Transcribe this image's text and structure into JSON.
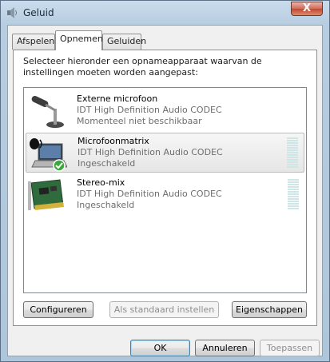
{
  "window": {
    "title": "Geluid",
    "close_glyph": "X"
  },
  "tabs": [
    {
      "label": "Afspelen",
      "active": false
    },
    {
      "label": "Opnemen",
      "active": true
    },
    {
      "label": "Geluiden",
      "active": false
    }
  ],
  "instruction": "Selecteer hieronder een opnameapparaat waarvan de instellingen moeten worden aangepast:",
  "devices": [
    {
      "name": "Externe microfoon",
      "driver": "IDT High Definition Audio CODEC",
      "status": "Momenteel niet beschikbaar",
      "icon": "desk-microphone-icon",
      "selected": false
    },
    {
      "name": "Microfoonmatrix",
      "driver": "IDT High Definition Audio CODEC",
      "status": "Ingeschakeld",
      "icon": "laptop-microphone-icon",
      "selected": true,
      "default_device": true
    },
    {
      "name": "Stereo-mix",
      "driver": "IDT High Definition Audio CODEC",
      "status": "Ingeschakeld",
      "icon": "sound-card-icon",
      "selected": false
    }
  ],
  "panel_buttons": {
    "configure": "Configureren",
    "set_default": "Als standaard instellen",
    "properties": "Eigenschappen"
  },
  "dialog_buttons": {
    "ok": "OK",
    "cancel": "Annuleren",
    "apply": "Toepassen"
  },
  "colors": {
    "close_button": "#c4472f",
    "meter_idle": "#cfe6e6",
    "default_check": "#3aa83a"
  }
}
